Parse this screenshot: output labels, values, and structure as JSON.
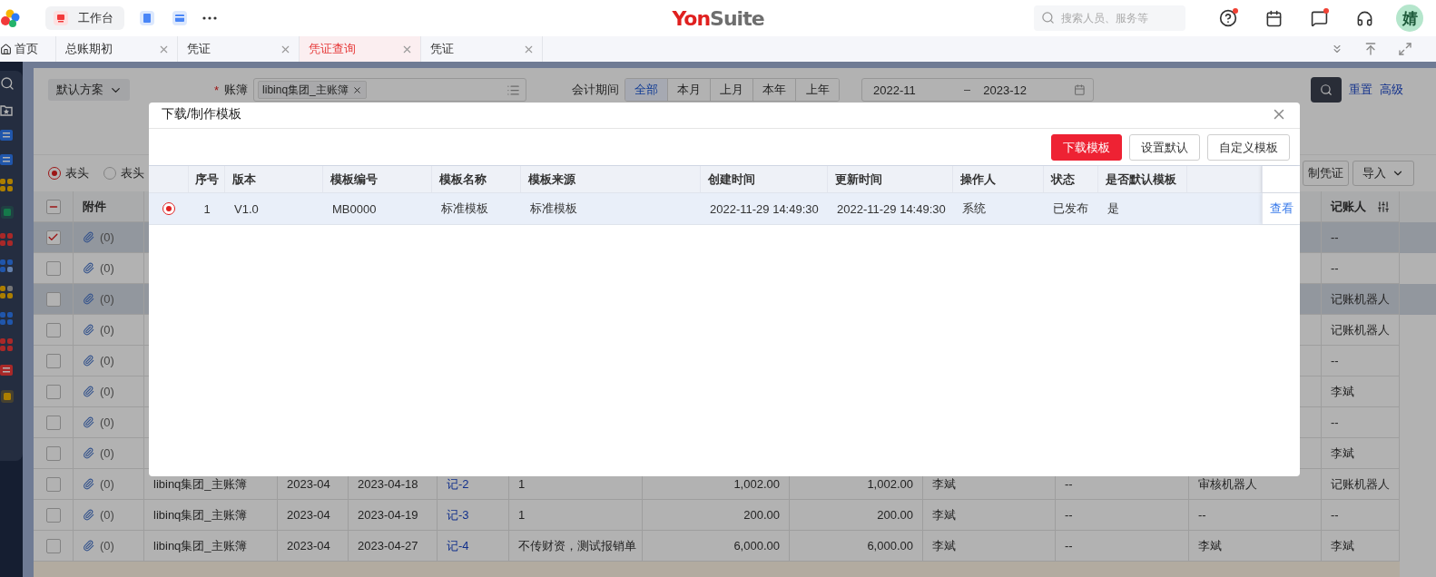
{
  "top_bar": {
    "workbench": "工作台",
    "logo": [
      "Yon",
      "Suite"
    ],
    "search": {
      "placeholder": "搜索人员、服务等"
    },
    "notifications": {
      "help": true,
      "messages": true
    },
    "avatar": "婧"
  },
  "tabs": [
    {
      "label": "首页",
      "kind": "home",
      "selected": false
    },
    {
      "label": "总账期初",
      "kind": "closable",
      "selected": false
    },
    {
      "label": "凭证",
      "kind": "closable",
      "selected": false
    },
    {
      "label": "凭证查询",
      "kind": "closable",
      "selected": true
    },
    {
      "label": "凭证",
      "kind": "closable",
      "selected": false
    }
  ],
  "filters": {
    "scheme": "默认方案",
    "required_mark": "*",
    "ledger_label": "账簿",
    "ledger_tag": "libinq集团_主账簿",
    "period_label": "会计期间",
    "periods": [
      {
        "label": "全部",
        "selected": true
      },
      {
        "label": "本月",
        "selected": false
      },
      {
        "label": "上月",
        "selected": false
      },
      {
        "label": "本年",
        "selected": false
      },
      {
        "label": "上年",
        "selected": false
      }
    ],
    "date_from": "2022-11",
    "date_to": "2023-12",
    "reset": "重置",
    "advanced": "高级"
  },
  "view_options": [
    {
      "label": "表头",
      "selected": true
    },
    {
      "label": "表头",
      "selected": false
    }
  ],
  "actions": {
    "copy": "制凭证",
    "import": "导入"
  },
  "table": {
    "header_checkbox": {
      "indeterminate": true
    },
    "columns": {
      "attachment": "附件",
      "bookkeeper": "记账人"
    },
    "rows": [
      {
        "checked": true,
        "selected": true,
        "attachment": "(0)",
        "bookkeeper": "--"
      },
      {
        "checked": false,
        "selected": false,
        "attachment": "(0)",
        "bookkeeper": "--"
      },
      {
        "checked": false,
        "selected": true,
        "attachment": "(0)",
        "bookkeeper": "记账机器人"
      },
      {
        "checked": false,
        "selected": false,
        "attachment": "(0)",
        "bookkeeper": "记账机器人"
      },
      {
        "checked": false,
        "selected": false,
        "attachment": "(0)",
        "bookkeeper": "--"
      },
      {
        "checked": false,
        "selected": false,
        "attachment": "(0)",
        "bookkeeper": "李斌"
      },
      {
        "checked": false,
        "selected": false,
        "attachment": "(0)",
        "bookkeeper": "--"
      },
      {
        "checked": false,
        "selected": false,
        "attachment": "(0)",
        "bookkeeper": "李斌"
      },
      {
        "checked": false,
        "selected": false,
        "attachment": "(0)",
        "column_3": "libinq集团_主账簿",
        "column_4": "2023-04",
        "column_5": "2023-04-18",
        "column_6": "记-2",
        "column_7": "1",
        "column_8": "1,002.00",
        "column_9": "1,002.00",
        "column_10": "李斌",
        "column_11": "--",
        "column_12": "审核机器人",
        "bookkeeper": "记账机器人"
      },
      {
        "checked": false,
        "selected": false,
        "attachment": "(0)",
        "column_3": "libinq集团_主账簿",
        "column_4": "2023-04",
        "column_5": "2023-04-19",
        "column_6": "记-3",
        "column_7": "1",
        "column_8": "200.00",
        "column_9": "200.00",
        "column_10": "李斌",
        "column_11": "--",
        "column_12": "--",
        "bookkeeper": "--"
      },
      {
        "checked": false,
        "selected": false,
        "attachment": "(0)",
        "column_3": "libinq集团_主账簿",
        "column_4": "2023-04",
        "column_5": "2023-04-27",
        "column_6": "记-4",
        "column_7": "不传财资，测试报销单",
        "column_8": "6,000.00",
        "column_9": "6,000.00",
        "column_10": "李斌",
        "column_11": "--",
        "column_12": "李斌",
        "bookkeeper": "李斌"
      }
    ]
  },
  "modal": {
    "title": "下载/制作模板",
    "buttons": [
      {
        "label": "下载模板",
        "kind": "primary"
      },
      {
        "label": "设置默认",
        "kind": "default"
      },
      {
        "label": "自定义模板",
        "kind": "default"
      }
    ],
    "columns": [
      "序号",
      "版本",
      "模板编号",
      "模板名称",
      "模板来源",
      "创建时间",
      "更新时间",
      "操作人",
      "状态",
      "是否默认模板"
    ],
    "rows": [
      {
        "selected": true,
        "cells": [
          "1",
          "V1.0",
          "MB0000",
          "标准模板",
          "标准模板",
          "2022-11-29 14:49:30",
          "2022-11-29 14:49:30",
          "系统",
          "已发布",
          "是"
        ],
        "action": "查看"
      }
    ]
  }
}
